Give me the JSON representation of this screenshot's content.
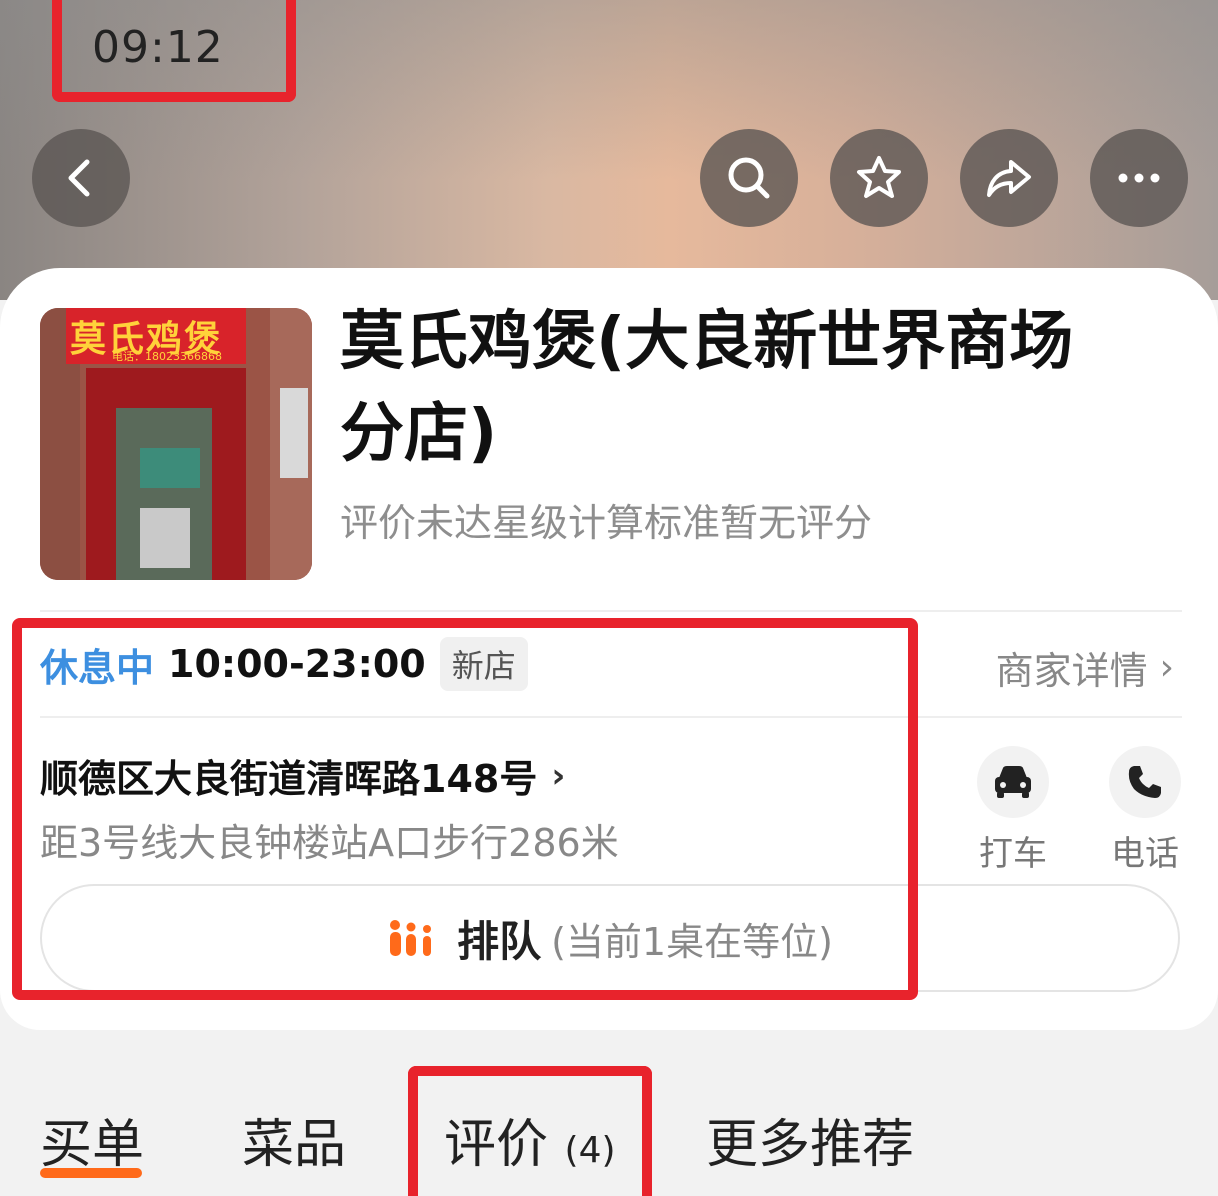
{
  "status_bar": {
    "time": "09:12"
  },
  "top_bar": {
    "back_icon": "chevron-left-icon",
    "actions": [
      "search-icon",
      "star-icon",
      "share-icon",
      "more-icon"
    ]
  },
  "shop": {
    "sign_text": "莫氏鸡煲",
    "sign_phone": "电话：18023366868",
    "title": "莫氏鸡煲(大良新世界商场分店)",
    "rating_note": "评价未达星级计算标准暂无评分"
  },
  "hours": {
    "status": "休息中",
    "time": "10:00-23:00",
    "tag": "新店",
    "status_color": "#3d8fe0"
  },
  "merchant_details": {
    "label": "商家详情"
  },
  "address": {
    "text": "顺德区大良街道清晖路148号",
    "distance": "距3号线大良钟楼站A口步行286米"
  },
  "actions": {
    "taxi": {
      "label": "打车",
      "icon": "car-icon"
    },
    "phone": {
      "label": "电话",
      "icon": "phone-icon"
    }
  },
  "queue": {
    "label": "排队",
    "sub": "(当前1桌在等位)",
    "icon": "people-queue-icon",
    "accent": "#ff6a1a"
  },
  "tabs": [
    {
      "label": "买单",
      "count": ""
    },
    {
      "label": "菜品",
      "count": ""
    },
    {
      "label": "评价",
      "count": "(4)"
    },
    {
      "label": "更多推荐",
      "count": ""
    }
  ],
  "active_tab": "买单",
  "annotation_color": "#e8232c"
}
